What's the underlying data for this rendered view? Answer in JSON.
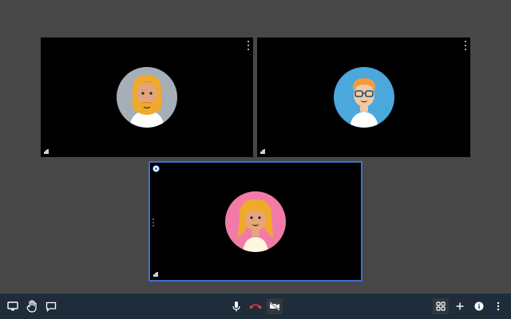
{
  "participants": [
    {
      "id": "a",
      "avatar": "bearded-man-avatar",
      "bg": "#a6aeb7"
    },
    {
      "id": "b",
      "avatar": "man-with-glasses-avatar",
      "bg": "#4aa8dc"
    },
    {
      "id": "c",
      "avatar": "woman-avatar",
      "bg": "#f27ba6",
      "pinned": true
    }
  ],
  "toolbar": {
    "left": [
      "screen-share-icon",
      "raise-hand-icon",
      "chat-icon"
    ],
    "center": [
      "microphone-icon",
      "hang-up-icon",
      "camera-off-icon"
    ],
    "right": [
      "grid-view-icon",
      "add-icon",
      "info-icon",
      "more-options-icon"
    ],
    "hangup_color": "#e53935",
    "icon_color": "#ffffff"
  },
  "colors": {
    "stage_bg": "#474747",
    "tile_bg": "#000000",
    "active_border": "#3b6fd1",
    "toolbar_bg": "#1f2d3a"
  }
}
